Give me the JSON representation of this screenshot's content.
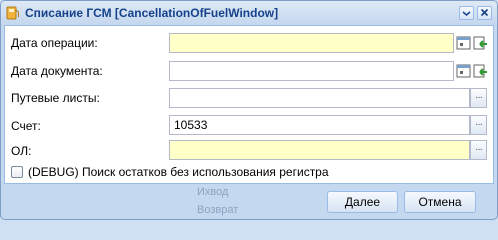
{
  "window": {
    "title": "Списание ГСМ [CancellationOfFuelWindow]"
  },
  "form": {
    "operation_date": {
      "label": "Дата операции:",
      "value": ""
    },
    "document_date": {
      "label": "Дата документа:",
      "value": ""
    },
    "waybills": {
      "label": "Путевые листы:",
      "value": "",
      "trigger": "···"
    },
    "account": {
      "label": "Счет:",
      "value": "10533",
      "trigger": "···"
    },
    "ol": {
      "label": "ОЛ:",
      "value": "",
      "trigger": "···"
    },
    "debug_checkbox": {
      "label": "(DEBUG) Поиск остатков без использования регистра",
      "checked": false
    }
  },
  "buttons": {
    "next": "Далее",
    "cancel": "Отмена"
  },
  "background_text": {
    "line1": "Ихвод",
    "line2": "Возврат"
  },
  "colors": {
    "title_text": "#15428b",
    "required_field": "#ffffc8",
    "border": "#99bbe8"
  },
  "icons": [
    "fuel-icon",
    "minimize-icon",
    "close-icon",
    "calendar-icon",
    "clear-icon",
    "ellipsis-icon"
  ]
}
